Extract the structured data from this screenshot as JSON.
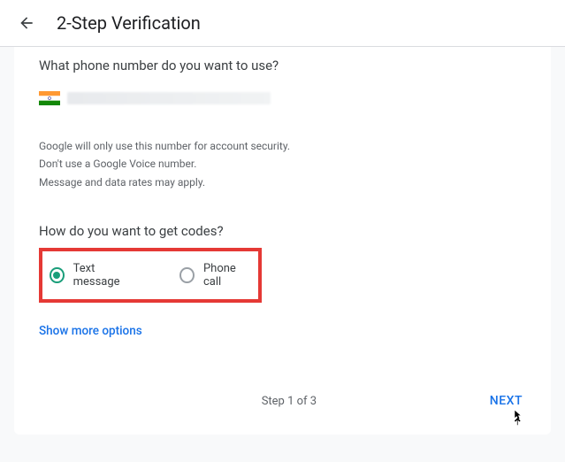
{
  "header": {
    "title": "2-Step Verification"
  },
  "content": {
    "q1": "What phone number do you want to use?",
    "note1": "Google will only use this number for account security.",
    "note2": "Don't use a Google Voice number.",
    "note3": "Message and data rates may apply.",
    "q2": "How do you want to get codes?",
    "radio1": "Text message",
    "radio2": "Phone call",
    "moreOptions": "Show more options"
  },
  "footer": {
    "step": "Step 1 of 3",
    "next": "NEXT"
  }
}
